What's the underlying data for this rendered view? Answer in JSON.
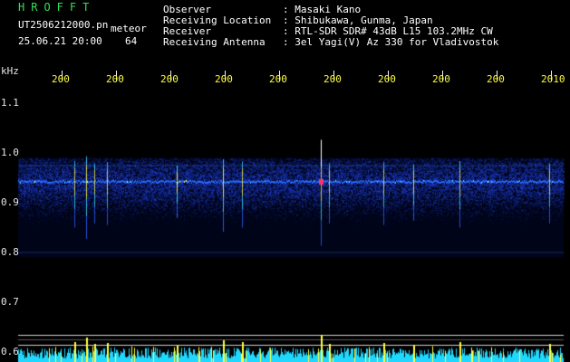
{
  "header": {
    "program": "HROFFT",
    "filename": "UT2506212000.pn",
    "datetime": "25.06.21 20:00",
    "mode": "meteor",
    "count": "64",
    "fields": [
      {
        "label": "Observer",
        "value": ": Masaki Kano"
      },
      {
        "label": "Receiving Location",
        "value": ": Shibukawa, Gunma, Japan"
      },
      {
        "label": "Receiver",
        "value": ": RTL-SDR SDR# 43dB L15 103.2MHz CW"
      },
      {
        "label": "Receiving Antenna",
        "value": ": 3el Yagi(V) Az 330 for Vladivostok"
      }
    ]
  },
  "colors": {
    "background": "#000000",
    "header_text": "#ffffff",
    "title_text": "#2fe05a",
    "axis_label_text": "#ffff40",
    "signal_band": "#1a3cff",
    "bottom_bars": "#20d8ff"
  },
  "chart_data": {
    "type": "heatmap",
    "ylabel": "kHz",
    "y_ticks": [
      "1.1",
      "1.0",
      "0.9",
      "0.8",
      "0.7",
      "0.6"
    ],
    "x_ticks": [
      "200",
      "200",
      "200",
      "200",
      "200",
      "200",
      "200",
      "200",
      "200",
      "2010"
    ],
    "ylim": [
      0.58,
      1.14
    ],
    "center_frequency_khz": 0.942,
    "band_range_khz": [
      0.79,
      0.99
    ],
    "meteor_events": [
      {
        "time_index": 0.37,
        "strength": 0.6
      },
      {
        "time_index": 0.58,
        "strength": 0.85
      },
      {
        "time_index": 0.74,
        "strength": 0.5
      },
      {
        "time_index": 0.96,
        "strength": 0.55
      },
      {
        "time_index": 2.25,
        "strength": 0.4
      },
      {
        "time_index": 3.1,
        "strength": 0.7
      },
      {
        "time_index": 3.45,
        "strength": 0.6
      },
      {
        "time_index": 4.9,
        "strength": 1.0
      },
      {
        "time_index": 5.05,
        "strength": 0.5
      },
      {
        "time_index": 6.05,
        "strength": 0.55
      },
      {
        "time_index": 6.6,
        "strength": 0.45
      },
      {
        "time_index": 7.45,
        "strength": 0.6
      },
      {
        "time_index": 9.1,
        "strength": 0.5
      }
    ]
  }
}
